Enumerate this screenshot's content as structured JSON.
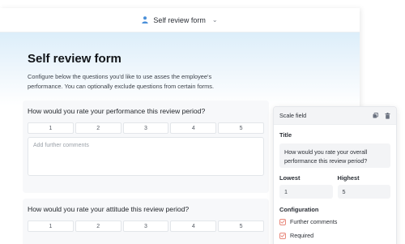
{
  "header": {
    "form_selector": "Self review form",
    "chevron": "⌄"
  },
  "page": {
    "title": "Self review form",
    "description": "Configure below the questions you'd like to use asses the employee's performance. You can optionally exclude questions from certain forms."
  },
  "questions": [
    {
      "title": "How would you rate your performance this review period?",
      "scale": [
        "1",
        "2",
        "3",
        "4",
        "5"
      ],
      "comments_placeholder": "Add further comments"
    },
    {
      "title": "How would you rate your attitude this review period?",
      "scale": [
        "1",
        "2",
        "3",
        "4",
        "5"
      ]
    }
  ],
  "side_panel": {
    "header": "Scale field",
    "title_label": "Title",
    "title_value": "How would you rate your overall performance this review period?",
    "lowest_label": "Lowest",
    "highest_label": "Highest",
    "lowest_value": "1",
    "highest_value": "5",
    "configuration_label": "Configuration",
    "options": [
      {
        "label": "Further comments",
        "checked": true
      },
      {
        "label": "Required",
        "checked": true
      }
    ]
  },
  "colors": {
    "accent_check": "#e8897c",
    "person_icon": "#4a90d9",
    "header_gradient": "#dceefa"
  },
  "icons": {
    "header": "person-icon",
    "panel_duplicate": "duplicate-icon",
    "panel_delete": "trash-icon",
    "check": "check-icon"
  }
}
